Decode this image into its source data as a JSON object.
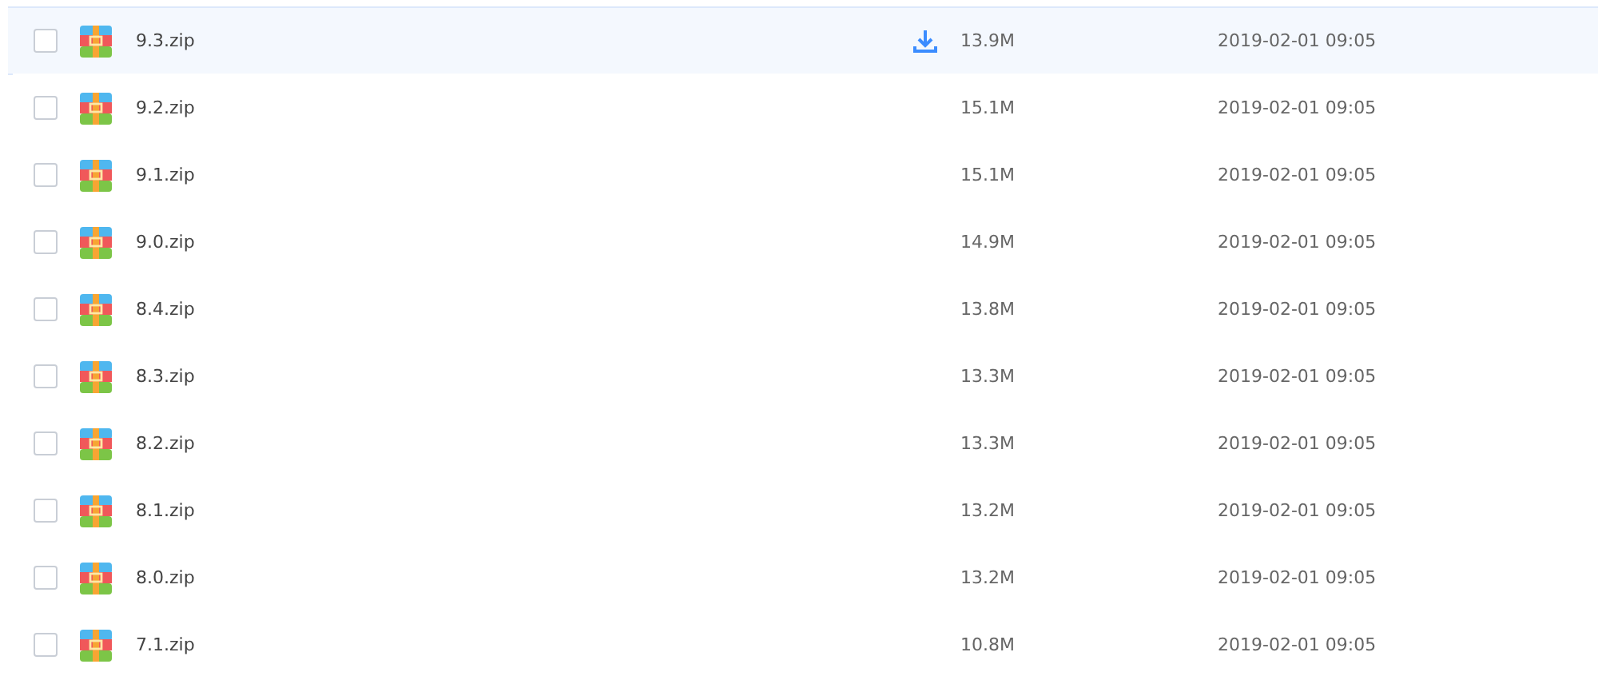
{
  "files": [
    {
      "name": "9.3.zip",
      "size": "13.9M",
      "date": "2019-02-01 09:05",
      "checked": false,
      "hovered": true
    },
    {
      "name": "9.2.zip",
      "size": "15.1M",
      "date": "2019-02-01 09:05",
      "checked": false,
      "hovered": false
    },
    {
      "name": "9.1.zip",
      "size": "15.1M",
      "date": "2019-02-01 09:05",
      "checked": false,
      "hovered": false
    },
    {
      "name": "9.0.zip",
      "size": "14.9M",
      "date": "2019-02-01 09:05",
      "checked": false,
      "hovered": false
    },
    {
      "name": "8.4.zip",
      "size": "13.8M",
      "date": "2019-02-01 09:05",
      "checked": false,
      "hovered": false
    },
    {
      "name": "8.3.zip",
      "size": "13.3M",
      "date": "2019-02-01 09:05",
      "checked": false,
      "hovered": false
    },
    {
      "name": "8.2.zip",
      "size": "13.3M",
      "date": "2019-02-01 09:05",
      "checked": false,
      "hovered": false
    },
    {
      "name": "8.1.zip",
      "size": "13.2M",
      "date": "2019-02-01 09:05",
      "checked": false,
      "hovered": false
    },
    {
      "name": "8.0.zip",
      "size": "13.2M",
      "date": "2019-02-01 09:05",
      "checked": false,
      "hovered": false
    },
    {
      "name": "7.1.zip",
      "size": "10.8M",
      "date": "2019-02-01 09:05",
      "checked": false,
      "hovered": false
    }
  ]
}
